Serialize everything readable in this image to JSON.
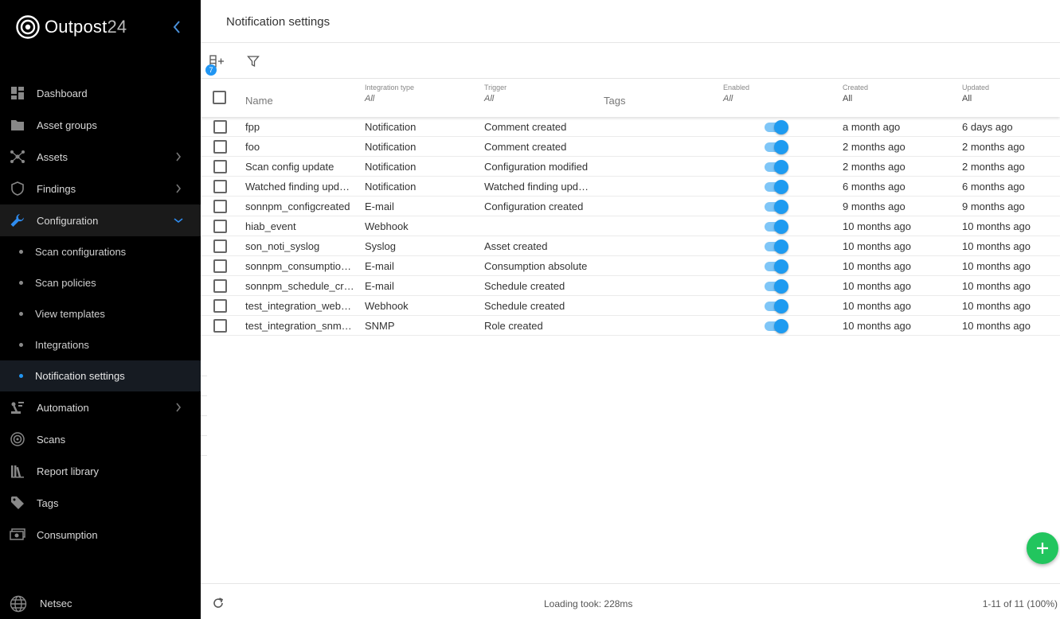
{
  "brand": {
    "name": "Outpost",
    "number": "24"
  },
  "sidebar": {
    "items": [
      {
        "label": "Dashboard",
        "icon": "dashboard-icon"
      },
      {
        "label": "Asset groups",
        "icon": "folder-icon"
      },
      {
        "label": "Assets",
        "icon": "network-icon",
        "chevron": "right"
      },
      {
        "label": "Findings",
        "icon": "shield-icon",
        "chevron": "right"
      },
      {
        "label": "Configuration",
        "icon": "wrench-icon",
        "chevron": "down",
        "active": true
      }
    ],
    "subitems": [
      {
        "label": "Scan configurations"
      },
      {
        "label": "Scan policies"
      },
      {
        "label": "View templates"
      },
      {
        "label": "Integrations"
      },
      {
        "label": "Notification settings",
        "active": true
      }
    ],
    "items2": [
      {
        "label": "Automation",
        "icon": "automation-icon",
        "chevron": "right"
      },
      {
        "label": "Scans",
        "icon": "radar-icon"
      },
      {
        "label": "Report library",
        "icon": "library-icon"
      },
      {
        "label": "Tags",
        "icon": "tag-icon"
      },
      {
        "label": "Consumption",
        "icon": "money-icon"
      }
    ],
    "footer": {
      "label": "Netsec",
      "icon": "globe-icon"
    }
  },
  "page": {
    "title": "Notification settings"
  },
  "toolbar": {
    "columns_badge": "7"
  },
  "table": {
    "headers": {
      "name": "Name",
      "integration_type": "Integration type",
      "integration_type_filter": "All",
      "trigger": "Trigger",
      "trigger_filter": "All",
      "tags": "Tags",
      "enabled": "Enabled",
      "enabled_filter": "All",
      "created": "Created",
      "created_filter": "All",
      "updated": "Updated",
      "updated_filter": "All"
    },
    "rows": [
      {
        "name": "fpp",
        "type": "Notification",
        "trigger": "Comment created",
        "tags": "",
        "enabled": true,
        "created": "a month ago",
        "updated": "6 days ago"
      },
      {
        "name": "foo",
        "type": "Notification",
        "trigger": "Comment created",
        "tags": "",
        "enabled": true,
        "created": "2 months ago",
        "updated": "2 months ago"
      },
      {
        "name": "Scan config update",
        "type": "Notification",
        "trigger": "Configuration modified",
        "tags": "",
        "enabled": true,
        "created": "2 months ago",
        "updated": "2 months ago"
      },
      {
        "name": "Watched finding upd…",
        "type": "Notification",
        "trigger": "Watched finding upd…",
        "tags": "",
        "enabled": true,
        "created": "6 months ago",
        "updated": "6 months ago"
      },
      {
        "name": "sonnpm_configcreated",
        "type": "E-mail",
        "trigger": "Configuration created",
        "tags": "",
        "enabled": true,
        "created": "9 months ago",
        "updated": "9 months ago"
      },
      {
        "name": "hiab_event",
        "type": "Webhook",
        "trigger": "",
        "tags": "",
        "enabled": true,
        "created": "10 months ago",
        "updated": "10 months ago"
      },
      {
        "name": "son_noti_syslog",
        "type": "Syslog",
        "trigger": "Asset created",
        "tags": "",
        "enabled": true,
        "created": "10 months ago",
        "updated": "10 months ago"
      },
      {
        "name": "sonnpm_consumptio…",
        "type": "E-mail",
        "trigger": "Consumption absolute",
        "tags": "",
        "enabled": true,
        "created": "10 months ago",
        "updated": "10 months ago"
      },
      {
        "name": "sonnpm_schedule_cr…",
        "type": "E-mail",
        "trigger": "Schedule created",
        "tags": "",
        "enabled": true,
        "created": "10 months ago",
        "updated": "10 months ago"
      },
      {
        "name": "test_integration_web…",
        "type": "Webhook",
        "trigger": "Schedule created",
        "tags": "",
        "enabled": true,
        "created": "10 months ago",
        "updated": "10 months ago"
      },
      {
        "name": "test_integration_snm…",
        "type": "SNMP",
        "trigger": "Role created",
        "tags": "",
        "enabled": true,
        "created": "10 months ago",
        "updated": "10 months ago"
      }
    ]
  },
  "status": {
    "loading": "Loading took: 228ms",
    "paging": "1-11 of 11 (100%)"
  },
  "colors": {
    "accent": "#2196f3",
    "toggle": "#1e9bf0",
    "fab": "#22c55e",
    "sidebar_bg": "#000000"
  }
}
